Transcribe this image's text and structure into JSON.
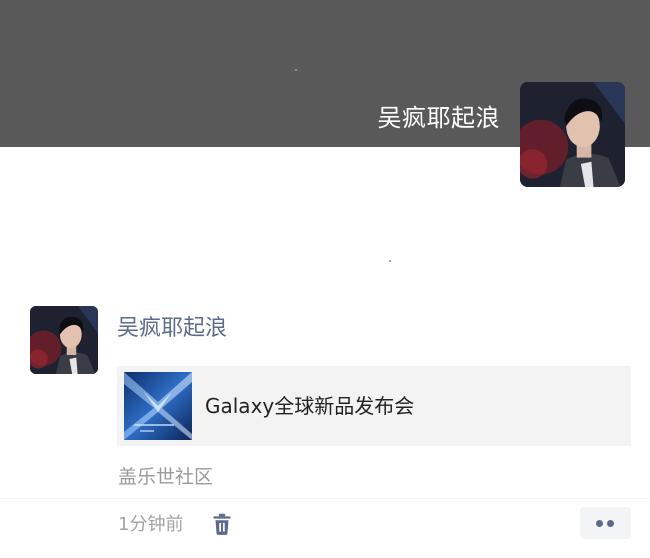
{
  "profile": {
    "name": "吴疯耶起浪",
    "avatar_icon": "profile-avatar-portrait",
    "cover_color": "#595959"
  },
  "post": {
    "author": "吴疯耶起浪",
    "author_color": "#5b6b8c",
    "share": {
      "title": "Galaxy全球新品发布会",
      "thumbnail_icon": "galaxy-event-thumbnail"
    },
    "source": "盖乐世社区",
    "time": "1分钟前",
    "delete_icon": "trash-icon",
    "more_icon": "more-dots-icon"
  }
}
